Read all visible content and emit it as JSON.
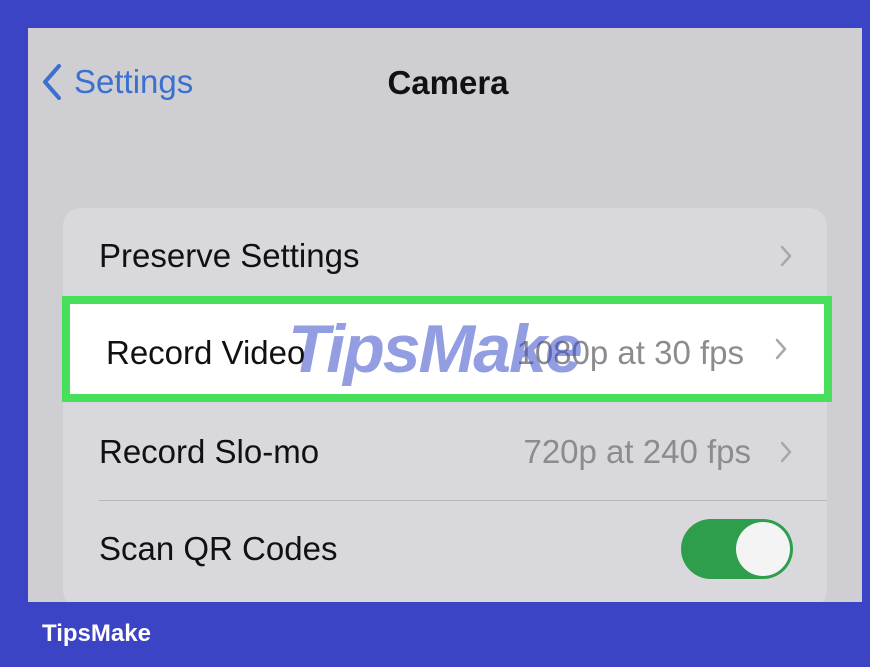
{
  "nav": {
    "back_label": "Settings",
    "back_icon": "chevron-left-icon",
    "title": "Camera"
  },
  "rows": [
    {
      "label": "Preserve Settings",
      "value": "",
      "accessory": "chevron-right-icon"
    },
    {
      "label": "Record Video",
      "value": "1080p at 30 fps",
      "accessory": "chevron-right-icon"
    },
    {
      "label": "Record Slo-mo",
      "value": "720p at 240 fps",
      "accessory": "chevron-right-icon"
    },
    {
      "label": "Scan QR Codes",
      "value": "",
      "accessory": "toggle",
      "toggle_on": true
    }
  ],
  "watermark": "TipsMake",
  "brand": "TipsMake",
  "colors": {
    "frame": "#3a44c4",
    "screen_bg": "#cfcfd3",
    "link": "#3b6fd0",
    "highlight_border": "#48e05a",
    "toggle_on": "#2f9e4c"
  }
}
